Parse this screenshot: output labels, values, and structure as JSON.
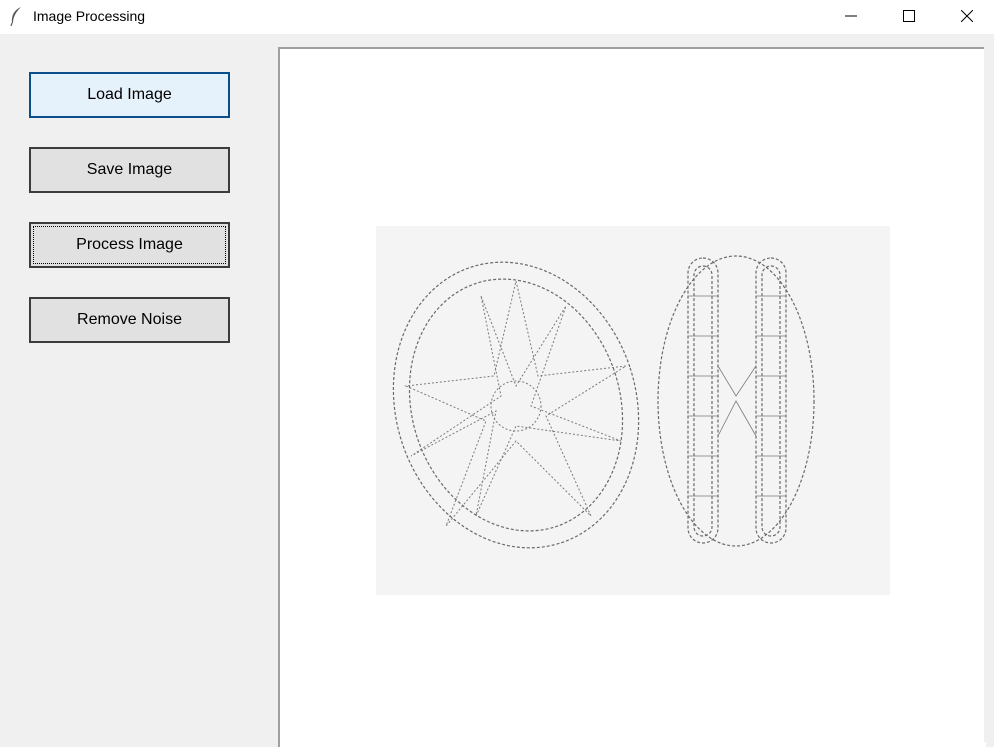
{
  "window": {
    "title": "Image Processing",
    "app_icon": "feather-icon",
    "controls": [
      "minimize-icon",
      "maximize-icon",
      "close-icon"
    ]
  },
  "sidebar": {
    "buttons": [
      {
        "label": "Load Image",
        "state": "hover"
      },
      {
        "label": "Save Image",
        "state": "normal"
      },
      {
        "label": "Process Image",
        "state": "focused"
      },
      {
        "label": "Remove Noise",
        "state": "normal"
      }
    ]
  },
  "canvas": {
    "image_description_icon": "jewel-sketch-image"
  },
  "colors": {
    "window_bg": "#f0f0f0",
    "button_bg": "#e1e1e1",
    "button_hover_bg": "#e5f1fb",
    "button_hover_border": "#0b4f8a",
    "canvas_bg": "#ffffff"
  }
}
